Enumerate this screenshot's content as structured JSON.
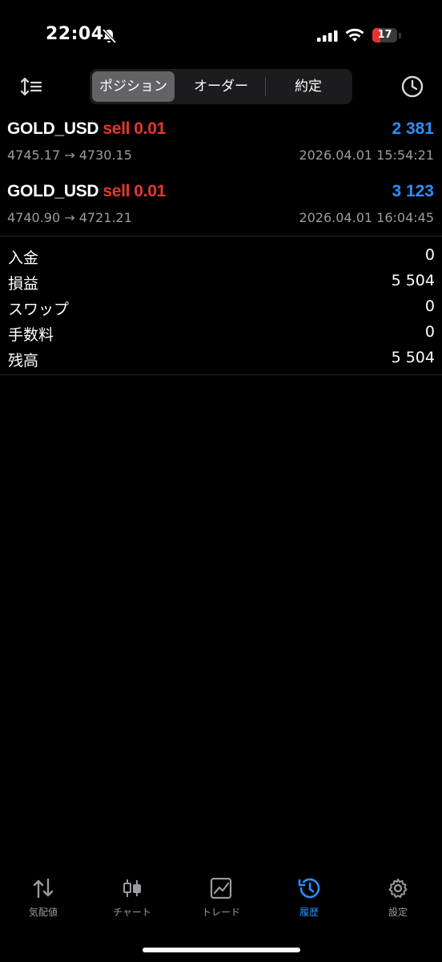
{
  "status_bar": {
    "time": "22:04",
    "battery": "17"
  },
  "toolbar": {
    "segments": [
      "ポジション",
      "オーダー",
      "約定"
    ],
    "active_segment": 0
  },
  "positions": [
    {
      "symbol": "GOLD_USD",
      "side": "sell",
      "volume": "0.01",
      "profit": "2 381",
      "prices": "4745.17 → 4730.15",
      "time": "2026.04.01 15:54:21"
    },
    {
      "symbol": "GOLD_USD",
      "side": "sell",
      "volume": "0.01",
      "profit": "3 123",
      "prices": "4740.90 → 4721.21",
      "time": "2026.04.01 16:04:45"
    }
  ],
  "summary": [
    {
      "label": "入金",
      "value": "0"
    },
    {
      "label": "損益",
      "value": "5 504"
    },
    {
      "label": "スワップ",
      "value": "0"
    },
    {
      "label": "手数料",
      "value": "0"
    },
    {
      "label": "残高",
      "value": "5 504"
    }
  ],
  "tabbar": {
    "items": [
      "気配値",
      "チャート",
      "トレード",
      "履歴",
      "設定"
    ],
    "active": 3
  },
  "colors": {
    "sell": "#e5372f",
    "profit": "#2e8ef5",
    "accent": "#2e8ef5"
  }
}
